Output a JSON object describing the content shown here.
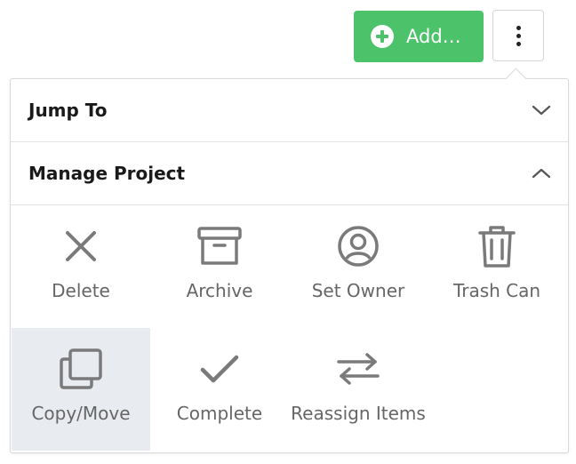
{
  "toolbar": {
    "add_label": "Add…",
    "add_icon": "plus-circle-icon",
    "more_icon": "vertical-ellipsis-icon",
    "accent_color": "#4cc36a"
  },
  "menu": {
    "sections": [
      {
        "title": "Jump To",
        "state": "collapsed",
        "icon": "chevron-down-icon"
      },
      {
        "title": "Manage Project",
        "state": "expanded",
        "icon": "chevron-up-icon"
      }
    ],
    "actions": [
      {
        "label": "Delete",
        "icon": "close-icon"
      },
      {
        "label": "Archive",
        "icon": "archive-box-icon"
      },
      {
        "label": "Set Owner",
        "icon": "user-circle-icon"
      },
      {
        "label": "Trash Can",
        "icon": "trash-icon"
      },
      {
        "label": "Copy/Move",
        "icon": "copy-icon",
        "selected": true
      },
      {
        "label": "Complete",
        "icon": "checkmark-icon"
      },
      {
        "label": "Reassign Items",
        "icon": "swap-arrows-icon"
      }
    ],
    "icon_color": "#7a7a7a",
    "selected_bg": "#e8ebf0"
  }
}
